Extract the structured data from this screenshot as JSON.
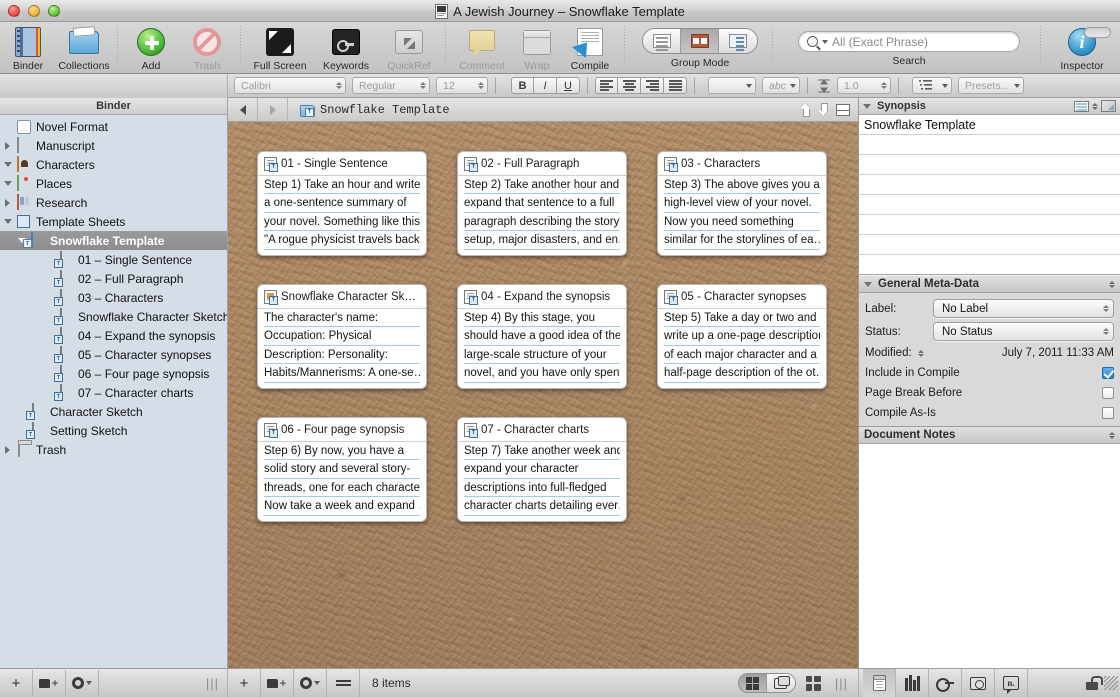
{
  "window": {
    "title": "A Jewish Journey – Snowflake Template",
    "doc_badge_icon": "document-badge-icon",
    "close_icon": "close-icon",
    "minimize_icon": "minimize-icon",
    "zoom_icon": "zoom-icon"
  },
  "toolbar": {
    "items": [
      {
        "label": "Binder",
        "icon": "binder-icon",
        "dim": false
      },
      {
        "label": "Collections",
        "icon": "collections-icon",
        "dim": false
      },
      {
        "label": "Add",
        "icon": "add-icon",
        "dim": false
      },
      {
        "label": "Trash",
        "icon": "trash-icon",
        "dim": true
      },
      {
        "label": "Full Screen",
        "icon": "full-screen-icon",
        "dim": false
      },
      {
        "label": "Keywords",
        "icon": "keywords-icon",
        "dim": false
      },
      {
        "label": "QuickRef",
        "icon": "quickref-icon",
        "dim": true
      },
      {
        "label": "Comment",
        "icon": "comment-icon",
        "dim": true
      },
      {
        "label": "Wrap",
        "icon": "wrap-icon",
        "dim": true
      },
      {
        "label": "Compile",
        "icon": "compile-icon",
        "dim": false
      },
      {
        "label": "Inspector",
        "icon": "inspector-icon",
        "dim": false
      }
    ],
    "group_mode": {
      "caption": "Group Mode",
      "options": [
        "outline-view",
        "corkboard-view",
        "outliner-view"
      ],
      "selected_index": 1
    },
    "search": {
      "caption": "Search",
      "placeholder": "All (Exact Phrase)",
      "value": "",
      "icon": "magnifier-icon"
    }
  },
  "format_bar": {
    "font_family": "Calibri",
    "font_style": "Regular",
    "font_size": "12",
    "bold": "B",
    "italic": "I",
    "underline": "U",
    "text_color_label": "",
    "spelling_label": "abc",
    "line_spacing": "1.0",
    "presets": "Presets..."
  },
  "binder": {
    "header": "Binder",
    "items": [
      {
        "label": "Novel Format",
        "icon": "info-doc-icon",
        "indent": 1,
        "disclosure": "none",
        "selected": false
      },
      {
        "label": "Manuscript",
        "icon": "manuscript-icon",
        "indent": 1,
        "disclosure": "right",
        "selected": false
      },
      {
        "label": "Characters",
        "icon": "characters-folder-icon",
        "indent": 1,
        "disclosure": "down",
        "selected": false
      },
      {
        "label": "Places",
        "icon": "places-folder-icon",
        "indent": 1,
        "disclosure": "down",
        "selected": false
      },
      {
        "label": "Research",
        "icon": "research-folder-icon",
        "indent": 1,
        "disclosure": "right",
        "selected": false
      },
      {
        "label": "Template Sheets",
        "icon": "template-sheets-icon",
        "indent": 1,
        "disclosure": "down",
        "selected": false
      },
      {
        "label": "Snowflake Template",
        "icon": "template-folder-icon",
        "indent": 2,
        "disclosure": "down",
        "selected": true
      },
      {
        "label": "01 – Single Sentence",
        "icon": "template-doc-icon",
        "indent": 4,
        "disclosure": "none",
        "selected": false
      },
      {
        "label": "02 – Full Paragraph",
        "icon": "template-doc-icon",
        "indent": 4,
        "disclosure": "none",
        "selected": false
      },
      {
        "label": "03 – Characters",
        "icon": "template-doc-icon",
        "indent": 4,
        "disclosure": "none",
        "selected": false
      },
      {
        "label": "Snowflake Character Sketch",
        "icon": "character-sketch-icon",
        "indent": 4,
        "disclosure": "none",
        "selected": false
      },
      {
        "label": "04 – Expand the synopsis",
        "icon": "template-doc-icon",
        "indent": 4,
        "disclosure": "none",
        "selected": false
      },
      {
        "label": "05 – Character synopses",
        "icon": "template-doc-icon",
        "indent": 4,
        "disclosure": "none",
        "selected": false
      },
      {
        "label": "06 – Four page synopsis",
        "icon": "template-doc-icon",
        "indent": 4,
        "disclosure": "none",
        "selected": false
      },
      {
        "label": "07 – Character charts",
        "icon": "template-doc-icon",
        "indent": 4,
        "disclosure": "none",
        "selected": false
      },
      {
        "label": "Character Sketch",
        "icon": "character-sketch-icon",
        "indent": 2,
        "disclosure": "none",
        "selected": false
      },
      {
        "label": "Setting Sketch",
        "icon": "setting-sketch-icon",
        "indent": 2,
        "disclosure": "none",
        "selected": false
      },
      {
        "label": "Trash",
        "icon": "trash-bin-icon",
        "indent": 1,
        "disclosure": "right",
        "selected": false
      }
    ],
    "footer": {
      "add_icon": "plus-icon",
      "add_folder_icon": "new-folder-icon",
      "settings_icon": "gear-icon",
      "grip_icon": "resize-grip-icon"
    }
  },
  "path_bar": {
    "back_icon": "back-arrow-icon",
    "forward_icon": "forward-arrow-icon",
    "folder_icon": "template-folder-icon",
    "title": "Snowflake Template",
    "up_icon": "go-up-icon",
    "down_icon": "go-down-icon",
    "split_icon": "split-view-icon"
  },
  "corkboard": {
    "cards": [
      {
        "title": "01 - Single Sentence",
        "icon": "template-doc-icon",
        "lines": [
          "Step 1) Take an hour and write",
          "a one-sentence summary of",
          "your novel. Something like this:",
          "\"A rogue physicist travels back…"
        ]
      },
      {
        "title": "02 - Full Paragraph",
        "icon": "template-doc-icon",
        "lines": [
          "Step 2) Take another hour and",
          "expand that sentence to a full",
          "paragraph describing the story",
          "setup, major disasters, and en…"
        ]
      },
      {
        "title": "03 - Characters",
        "icon": "template-doc-icon",
        "lines": [
          "Step 3) The above gives you a",
          "high-level view of your novel.",
          "Now you need something",
          "similar for the storylines of ea…"
        ]
      },
      {
        "title": "Snowflake Character Sk…",
        "icon": "character-sketch-icon",
        "lines": [
          "The character's name:",
          "Occupation: Physical",
          "Description:  Personality:",
          "Habits/Mannerisms:  A one-se…"
        ]
      },
      {
        "title": "04 - Expand the synopsis",
        "icon": "template-doc-icon",
        "lines": [
          "Step 4) By this stage, you",
          "should have a good idea of the",
          "large-scale structure of your",
          "novel, and you have only spent…"
        ]
      },
      {
        "title": "05 - Character synopses",
        "icon": "template-doc-icon",
        "lines": [
          "Step 5) Take a day or two and",
          "write up a one-page description",
          "of each major character and a",
          "half-page description of the ot…"
        ]
      },
      {
        "title": "06 - Four page synopsis",
        "icon": "template-doc-icon",
        "lines": [
          "Step 6) By now, you have a",
          "solid story and several story-",
          "threads, one for each character.",
          "Now take a week and expand …"
        ]
      },
      {
        "title": "07 - Character charts",
        "icon": "template-doc-icon",
        "lines": [
          "Step 7) Take another week and",
          "expand your character",
          "descriptions into full-fledged",
          "character charts detailing ever…"
        ]
      }
    ]
  },
  "inspector": {
    "synopsis": {
      "header": "Synopsis",
      "text": "Snowflake Template",
      "card_icon": "index-card-icon",
      "image_icon": "image-placeholder-icon",
      "stepper_icon": "stepper-icon"
    },
    "meta": {
      "header": "General Meta-Data",
      "label_key": "Label:",
      "label_value": "No Label",
      "status_key": "Status:",
      "status_value": "No Status",
      "modified_key": "Modified:",
      "modified_value": "July 7, 2011 11:33 AM",
      "include_in_compile": "Include in Compile",
      "include_in_compile_checked": true,
      "page_break_before": "Page Break Before",
      "page_break_before_checked": false,
      "compile_as_is": "Compile As-Is",
      "compile_as_is_checked": false
    },
    "notes": {
      "header": "Document Notes"
    }
  },
  "status_bar": {
    "add_icon": "plus-icon",
    "add_folder_icon": "new-folder-icon",
    "settings_icon": "gear-icon",
    "swap_icon": "swap-arrows-icon",
    "item_count": "8 items",
    "view_modes": [
      "corkboard-mode",
      "stack-mode"
    ],
    "view_selected_index": 0,
    "grid_icon": "grid-view-icon",
    "grip_icon": "resize-grip-icon",
    "inspector_tabs": [
      {
        "icon": "notes-tab-icon",
        "on": true
      },
      {
        "icon": "references-tab-icon",
        "on": false
      },
      {
        "icon": "keywords-tab-icon",
        "on": false
      },
      {
        "icon": "snapshots-tab-icon",
        "on": false
      },
      {
        "icon": "comments-tab-icon",
        "on": false
      }
    ],
    "lock_icon": "lock-icon",
    "resizer_icon": "window-resizer-icon"
  }
}
